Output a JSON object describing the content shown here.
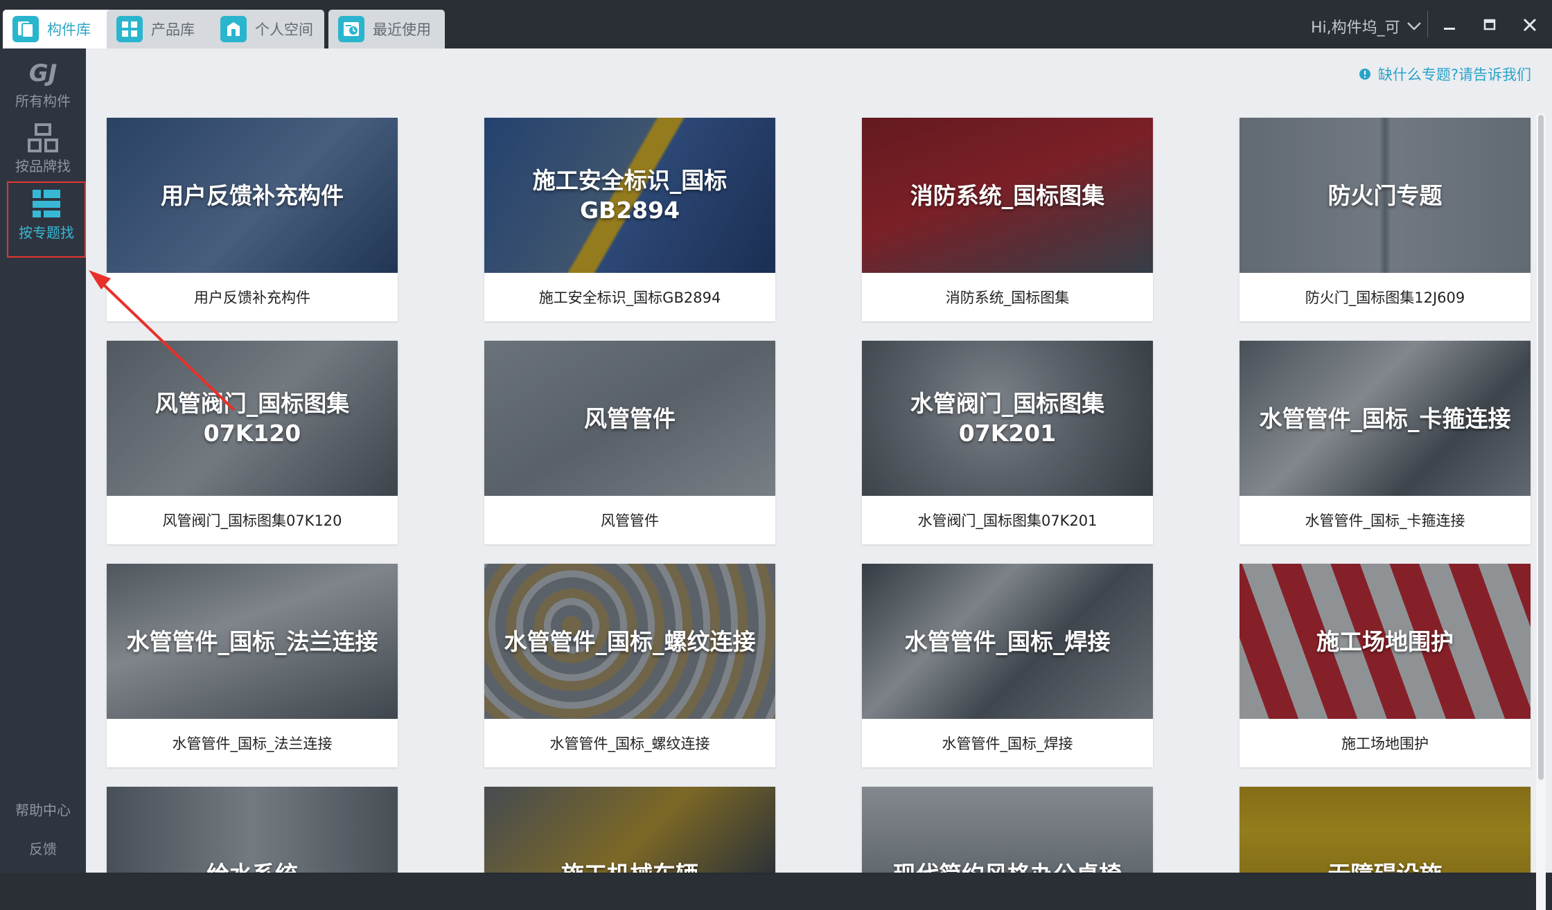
{
  "tabs": [
    {
      "label": "构件库",
      "active": true
    },
    {
      "label": "产品库",
      "active": false
    },
    {
      "label": "个人空间",
      "active": false
    },
    {
      "label": "最近使用",
      "active": false
    }
  ],
  "user": {
    "greeting": "Hi,构件坞_可"
  },
  "sidebar": {
    "logo_text": "GJ",
    "all": "所有构件",
    "brand": "按品牌找",
    "topic": "按专题找",
    "help": "帮助中心",
    "feedback": "反馈"
  },
  "notice": {
    "text": "缺什么专题?请告诉我们"
  },
  "cards": [
    {
      "title": "用户反馈补充构件",
      "caption": "用户反馈补充构件"
    },
    {
      "title": "施工安全标识_国标\nGB2894",
      "caption": "施工安全标识_国标GB2894"
    },
    {
      "title": "消防系统_国标图集",
      "caption": "消防系统_国标图集"
    },
    {
      "title": "防火门专题",
      "caption": "防火门_国标图集12J609"
    },
    {
      "title": "风管阀门_国标图集\n07K120",
      "caption": "风管阀门_国标图集07K120"
    },
    {
      "title": "风管管件",
      "caption": "风管管件"
    },
    {
      "title": "水管阀门_国标图集\n07K201",
      "caption": "水管阀门_国标图集07K201"
    },
    {
      "title": "水管管件_国标_卡箍连接",
      "caption": "水管管件_国标_卡箍连接"
    },
    {
      "title": "水管管件_国标_法兰连接",
      "caption": "水管管件_国标_法兰连接"
    },
    {
      "title": "水管管件_国标_螺纹连接",
      "caption": "水管管件_国标_螺纹连接"
    },
    {
      "title": "水管管件_国标_焊接",
      "caption": "水管管件_国标_焊接"
    },
    {
      "title": "施工场地围护",
      "caption": "施工场地围护"
    },
    {
      "title": "给水系统",
      "caption": ""
    },
    {
      "title": "施工机械车辆",
      "caption": ""
    },
    {
      "title": "现代简约风格办公桌椅",
      "caption": ""
    },
    {
      "title": "无障碍设施",
      "caption": ""
    }
  ],
  "colors": {
    "accent": "#2ab5cf",
    "highlight_border": "#e2362e",
    "sidebar_bg": "#2f3540",
    "topbar_bg": "#2a2f36",
    "main_bg": "#ebedf0"
  }
}
